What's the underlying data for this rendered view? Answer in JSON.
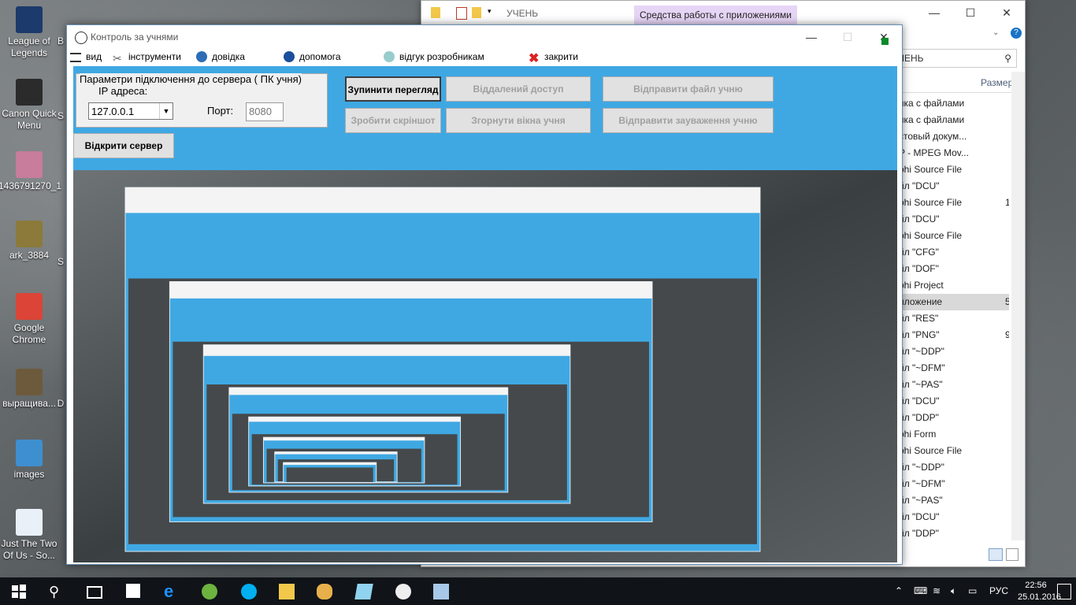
{
  "desktop": {
    "icons": [
      {
        "label": "League of Legends",
        "color": "#1c3a6b"
      },
      {
        "label": "Canon Quick Menu",
        "color": "#2b2b2b"
      },
      {
        "label": "1436791270_1",
        "color": "#c77d9b"
      },
      {
        "label": "ark_3884",
        "color": "#8b7a3a"
      },
      {
        "label": "Google Chrome",
        "color": "#db4437"
      },
      {
        "label": "выращива...",
        "color": "#6d5a3d"
      },
      {
        "label": "images",
        "color": "#3e8fd0"
      },
      {
        "label": "Just The Two Of Us - So...",
        "color": "#e9f0f7"
      }
    ],
    "partial_labels": [
      "B",
      "S",
      "S",
      "D"
    ]
  },
  "explorer": {
    "context_tab": "Средства работы с приложениями",
    "title": "УЧЕНЬ",
    "address": "ЧЕНЬ",
    "size_header": "Размер",
    "files": [
      {
        "name": "пка с файлами",
        "size": ""
      },
      {
        "name": "пка с файлами",
        "size": ""
      },
      {
        "name": "стовый докум...",
        "size": ""
      },
      {
        "name": "P - MPEG Mov...",
        "size": ""
      },
      {
        "name": "phi Source File",
        "size": ""
      },
      {
        "name": "йл \"DCU\"",
        "size": ""
      },
      {
        "name": "phi Source File",
        "size": "1"
      },
      {
        "name": "йл \"DCU\"",
        "size": ""
      },
      {
        "name": "phi Source File",
        "size": ""
      },
      {
        "name": "йл \"CFG\"",
        "size": ""
      },
      {
        "name": "йл \"DOF\"",
        "size": ""
      },
      {
        "name": "phi Project",
        "size": ""
      },
      {
        "name": "иложение",
        "size": "5",
        "selected": true
      },
      {
        "name": "йл \"RES\"",
        "size": ""
      },
      {
        "name": "йл \"PNG\"",
        "size": "9"
      },
      {
        "name": "йл \"~DDP\"",
        "size": ""
      },
      {
        "name": "йл \"~DFM\"",
        "size": ""
      },
      {
        "name": "йл \"~PAS\"",
        "size": ""
      },
      {
        "name": "йл \"DCU\"",
        "size": ""
      },
      {
        "name": "йл \"DDP\"",
        "size": ""
      },
      {
        "name": "phi Form",
        "size": ""
      },
      {
        "name": "phi Source File",
        "size": ""
      },
      {
        "name": "йл \"~DDP\"",
        "size": ""
      },
      {
        "name": "йл \"~DFM\"",
        "size": ""
      },
      {
        "name": "йл \"~PAS\"",
        "size": ""
      },
      {
        "name": "йл \"DCU\"",
        "size": ""
      },
      {
        "name": "йл \"DDP\"",
        "size": ""
      }
    ]
  },
  "app": {
    "title": "Контроль за учнями",
    "menu": [
      {
        "label": "вид",
        "icon": "view-icon"
      },
      {
        "label": "інструменти",
        "icon": "tools-icon"
      },
      {
        "label": "довідка",
        "icon": "info-icon"
      },
      {
        "label": "допомога",
        "icon": "help-icon"
      },
      {
        "label": "відгук розробникам",
        "icon": "feedback-icon"
      },
      {
        "label": "закрити",
        "icon": "close-red-icon"
      }
    ],
    "server_group": {
      "legend": "Параметри підключення до  сервера  ( ПК учня)",
      "ip_label": "IP адреса:",
      "ip_value": "127.0.0.1",
      "port_label": "Порт:",
      "port_value": "8080",
      "open_server": "Відкрити сервер"
    },
    "buttons": {
      "stop_view": "Зупинити перегляд",
      "screenshot": "Зробити скріншот",
      "remote": "Віддалений доступ",
      "minimize": "Згорнути вікна учня",
      "send_file": "Відправити файл учню",
      "send_note": "Відправити  зауваження учню"
    }
  },
  "taskbar": {
    "lang": "РУС",
    "time": "22:56",
    "date": "25.01.2016"
  },
  "colors": {
    "client_bg": "#3fa8e3",
    "taskbar": "#101418",
    "ctx_tab": "#e7d5f6"
  }
}
